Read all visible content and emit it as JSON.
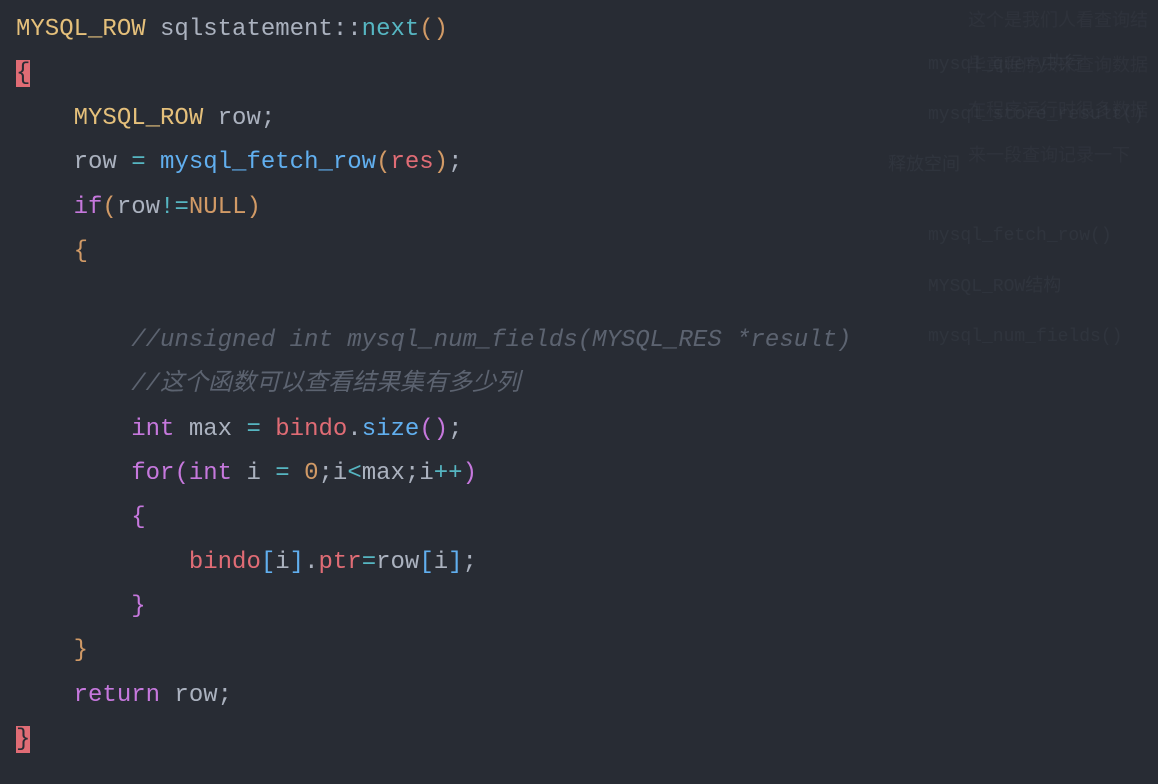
{
  "code": {
    "line1": {
      "type": "MYSQL_ROW",
      "class": "sqlstatement",
      "scope": "::",
      "func": "next",
      "parens": "()"
    },
    "line2": {
      "brace": "{"
    },
    "line3": {
      "type": "MYSQL_ROW",
      "var": "row",
      "semi": ";"
    },
    "line4": {
      "var1": "row",
      "op": " = ",
      "func": "mysql_fetch_row",
      "lparen": "(",
      "param": "res",
      "rparen": ")",
      "semi": ";"
    },
    "line5": {
      "kw": "if",
      "lparen": "(",
      "var": "row",
      "op": "!=",
      "null": "NULL",
      "rparen": ")"
    },
    "line6": {
      "brace": "{"
    },
    "line7": {
      "comment": "//unsigned int mysql_num_fields(MYSQL_RES *result)"
    },
    "line8": {
      "comment": "//这个函数可以查看结果集有多少列"
    },
    "line9": {
      "type": "int",
      "var": "max",
      "op": " = ",
      "obj": "bindo",
      "dot": ".",
      "method": "size",
      "parens": "()",
      "semi": ";"
    },
    "line10": {
      "kw": "for",
      "lparen": "(",
      "type": "int",
      "var": "i",
      "op1": " = ",
      "num": "0",
      "semi1": ";",
      "var2": "i",
      "op2": "<",
      "var3": "max",
      "semi2": ";",
      "var4": "i",
      "op3": "++",
      "rparen": ")"
    },
    "line11": {
      "brace": "{"
    },
    "line12": {
      "obj": "bindo",
      "lbr": "[",
      "idx": "i",
      "rbr": "]",
      "dot": ".",
      "prop": "ptr",
      "op": "=",
      "var": "row",
      "lbr2": "[",
      "idx2": "i",
      "rbr2": "]",
      "semi": ";"
    },
    "line13": {
      "brace": "}"
    },
    "line14": {
      "brace": "}"
    },
    "line15": {
      "kw": "return",
      "var": " row",
      "semi": ";"
    },
    "line16": {
      "brace": "}"
    }
  },
  "ghost": {
    "t1": "mysql_query执行",
    "t2": "mysql_store_result()",
    "t3": "释放空间",
    "t4": "mysql_fetch_row()",
    "t5": "MYSQL_ROW结构",
    "t6": "mysql_num_fields()",
    "r1": "这个是我们人看查询结",
    "r2": "毕竟程序只来查询数据",
    "r3": "在程序运行时很多数据",
    "r4": "来一段查询记录一下"
  }
}
